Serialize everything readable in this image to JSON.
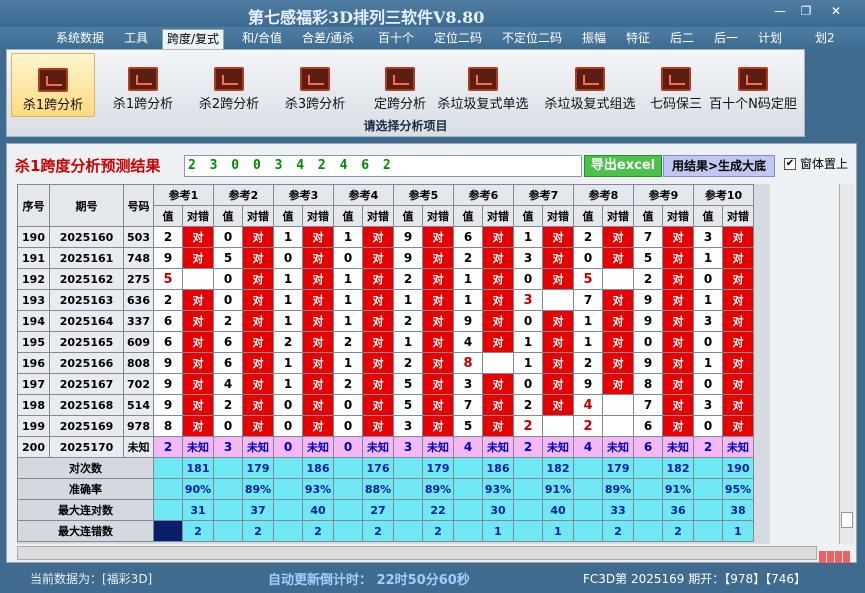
{
  "app": {
    "title": "第七感福彩3D排列三软件V8.80",
    "win_min": "—",
    "win_restore": "❐",
    "win_close": "✕"
  },
  "menu": [
    "系统数据",
    "工具",
    "跨度/复式",
    "和/合值",
    "合差/通杀",
    "百十个",
    "定位二码",
    "不定位二码",
    "振幅",
    "特征",
    "后二",
    "后一",
    "计划",
    "划2"
  ],
  "menu_active": 2,
  "ribbon": {
    "buttons": [
      "杀1跨分析",
      "杀1跨分析",
      "杀2跨分析",
      "杀3跨分析",
      "定跨分析",
      "杀垃圾复式单选",
      "杀垃圾复式组选",
      "七码保三",
      "百十个N码定胆"
    ],
    "selected": 0,
    "caption": "请选择分析项目"
  },
  "panel": {
    "title": "杀1跨度分析预测结果",
    "result_value": "2 3 0 0 3 4 2 4 6 2",
    "export_label": "导出excel",
    "generate_label": "用结果>生成大底",
    "topmost_label": "窗体置上",
    "topmost_checked": "✔"
  },
  "table": {
    "headers": {
      "seq": "序号",
      "issue": "期号",
      "code": "号码",
      "value": "值",
      "result": "对错"
    },
    "refs": [
      "参考1",
      "参考2",
      "参考3",
      "参考4",
      "参考5",
      "参考6",
      "参考7",
      "参考8",
      "参考9",
      "参考10"
    ],
    "hit_label": "对",
    "rows": [
      {
        "seq": "190",
        "issue": "2025160",
        "code": "503",
        "vals": [
          "2",
          "0",
          "1",
          "1",
          "9",
          "6",
          "1",
          "2",
          "7",
          "3"
        ],
        "res": [
          "对",
          "对",
          "对",
          "对",
          "对",
          "对",
          "对",
          "对",
          "对",
          "对"
        ]
      },
      {
        "seq": "191",
        "issue": "2025161",
        "code": "748",
        "vals": [
          "9",
          "5",
          "0",
          "0",
          "9",
          "2",
          "3",
          "0",
          "5",
          "1"
        ],
        "res": [
          "对",
          "对",
          "对",
          "对",
          "对",
          "对",
          "对",
          "对",
          "对",
          "对"
        ]
      },
      {
        "seq": "192",
        "issue": "2025162",
        "code": "275",
        "vals": [
          "5",
          "0",
          "1",
          "1",
          "2",
          "1",
          "0",
          "5",
          "2",
          "0"
        ],
        "res": [
          "",
          "对",
          "对",
          "对",
          "对",
          "对",
          "对",
          "",
          "对",
          "对"
        ]
      },
      {
        "seq": "193",
        "issue": "2025163",
        "code": "636",
        "vals": [
          "2",
          "0",
          "1",
          "1",
          "1",
          "1",
          "3",
          "7",
          "9",
          "1"
        ],
        "res": [
          "对",
          "对",
          "对",
          "对",
          "对",
          "对",
          "",
          "对",
          "对",
          "对"
        ]
      },
      {
        "seq": "194",
        "issue": "2025164",
        "code": "337",
        "vals": [
          "6",
          "2",
          "1",
          "1",
          "2",
          "9",
          "0",
          "1",
          "9",
          "3"
        ],
        "res": [
          "对",
          "对",
          "对",
          "对",
          "对",
          "对",
          "对",
          "对",
          "对",
          "对"
        ]
      },
      {
        "seq": "195",
        "issue": "2025165",
        "code": "609",
        "vals": [
          "6",
          "6",
          "2",
          "2",
          "1",
          "4",
          "1",
          "1",
          "0",
          "0"
        ],
        "res": [
          "对",
          "对",
          "对",
          "对",
          "对",
          "对",
          "对",
          "对",
          "对",
          "对"
        ]
      },
      {
        "seq": "196",
        "issue": "2025166",
        "code": "808",
        "vals": [
          "9",
          "6",
          "1",
          "1",
          "2",
          "8",
          "1",
          "2",
          "9",
          "1"
        ],
        "res": [
          "对",
          "对",
          "对",
          "对",
          "对",
          "",
          "对",
          "对",
          "对",
          "对"
        ]
      },
      {
        "seq": "197",
        "issue": "2025167",
        "code": "702",
        "vals": [
          "9",
          "4",
          "1",
          "2",
          "5",
          "3",
          "0",
          "9",
          "8",
          "0"
        ],
        "res": [
          "对",
          "对",
          "对",
          "对",
          "对",
          "对",
          "对",
          "对",
          "对",
          "对"
        ]
      },
      {
        "seq": "198",
        "issue": "2025168",
        "code": "514",
        "vals": [
          "9",
          "2",
          "0",
          "0",
          "5",
          "7",
          "2",
          "4",
          "7",
          "3"
        ],
        "res": [
          "对",
          "对",
          "对",
          "对",
          "对",
          "对",
          "对",
          "",
          "对",
          "对"
        ]
      },
      {
        "seq": "199",
        "issue": "2025169",
        "code": "978",
        "vals": [
          "8",
          "0",
          "0",
          "0",
          "3",
          "5",
          "2",
          "2",
          "6",
          "0"
        ],
        "res": [
          "对",
          "对",
          "对",
          "对",
          "对",
          "对",
          "",
          "",
          "对",
          "对"
        ]
      },
      {
        "seq": "200",
        "issue": "2025170",
        "code": "未知",
        "vals": [
          "2",
          "3",
          "0",
          "0",
          "3",
          "4",
          "2",
          "4",
          "6",
          "2"
        ],
        "res": [
          "未知",
          "未知",
          "未知",
          "未知",
          "未知",
          "未知",
          "未知",
          "未知",
          "未知",
          "未知"
        ],
        "unknown": true
      }
    ],
    "hit_cells": [
      [
        2,
        0
      ],
      [
        2,
        7
      ],
      [
        3,
        6
      ],
      [
        6,
        5
      ],
      [
        8,
        7
      ],
      [
        9,
        6
      ],
      [
        9,
        7
      ]
    ],
    "stats": [
      {
        "label": "对次数",
        "vals": [
          "181",
          "179",
          "186",
          "176",
          "179",
          "186",
          "182",
          "179",
          "182",
          "190"
        ]
      },
      {
        "label": "准确率",
        "vals": [
          "90%",
          "89%",
          "93%",
          "88%",
          "89%",
          "93%",
          "91%",
          "89%",
          "91%",
          "95%"
        ]
      },
      {
        "label": "最大连对数",
        "vals": [
          "31",
          "37",
          "40",
          "27",
          "22",
          "30",
          "40",
          "33",
          "36",
          "38"
        ]
      },
      {
        "label": "最大连错数",
        "vals": [
          "2",
          "2",
          "2",
          "2",
          "2",
          "1",
          "1",
          "2",
          "2",
          "1"
        ]
      }
    ]
  },
  "status": {
    "current_data": "当前数据为：[福彩3D]",
    "countdown": "自动更新倒计时：  22时50分60秒",
    "issue_info": "FC3D第 2025169 期开：【978】【746】"
  }
}
